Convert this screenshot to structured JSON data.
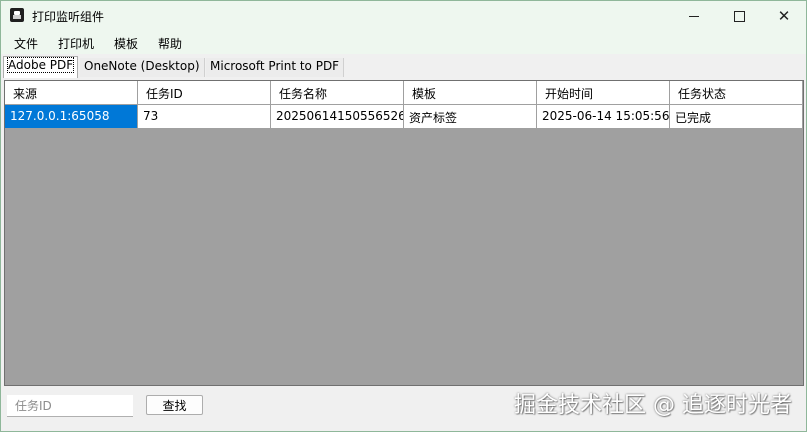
{
  "window": {
    "title": "打印监听组件",
    "minimize_glyph": "",
    "close_glyph": "✕"
  },
  "menu": [
    "文件",
    "打印机",
    "模板",
    "帮助"
  ],
  "tabs": [
    {
      "label": "Adobe PDF",
      "active": true
    },
    {
      "label": "OneNote (Desktop)",
      "active": false
    },
    {
      "label": "Microsoft Print to PDF",
      "active": false
    }
  ],
  "table": {
    "columns": [
      "来源",
      "任务ID",
      "任务名称",
      "模板",
      "开始时间",
      "任务状态"
    ],
    "rows": [
      [
        "127.0.0.1:65058",
        "73",
        "20250614150556526",
        "资产标签",
        "2025-06-14 15:05:56",
        "已完成"
      ]
    ]
  },
  "search": {
    "placeholder": "任务ID",
    "value": "",
    "button_label": "查找"
  },
  "watermark": "掘金技术社区 @ 追逐时光者",
  "colors": {
    "titlebar_bg": "#eef7ef",
    "selection": "#0078d7",
    "grid_background": "#a0a0a0"
  }
}
